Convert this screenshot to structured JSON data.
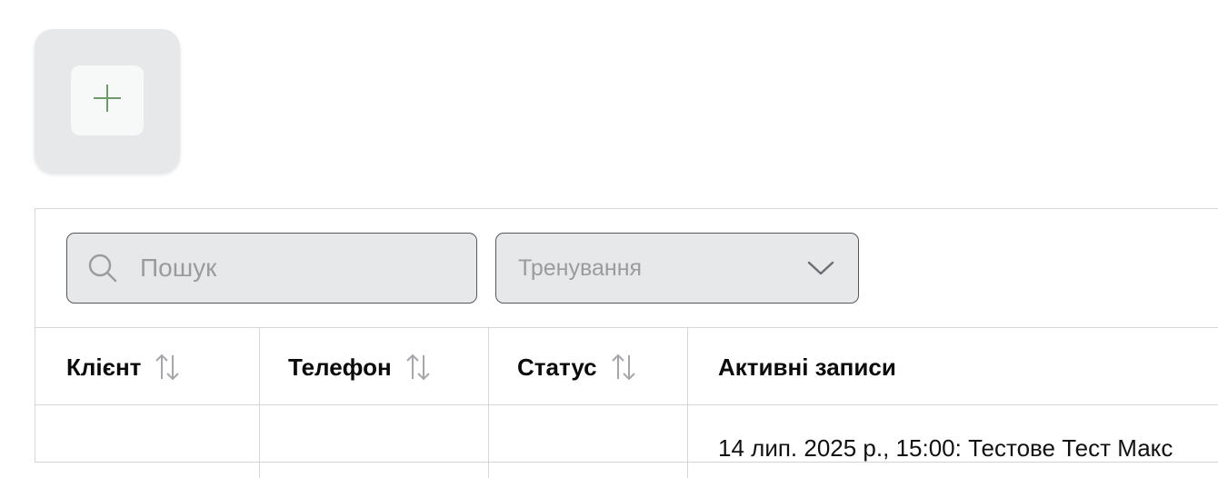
{
  "add_card": {
    "icon": "plus-icon",
    "accent_color": "#6f9a6a"
  },
  "filters": {
    "search": {
      "placeholder": "Пошук",
      "value": "",
      "icon": "search-icon"
    },
    "training_select": {
      "selected_label": "Тренування",
      "icon": "chevron-down-icon"
    }
  },
  "table": {
    "columns": [
      {
        "label": "Клієнт",
        "sortable": true
      },
      {
        "label": "Телефон",
        "sortable": true
      },
      {
        "label": "Статус",
        "sortable": true
      },
      {
        "label": "Активні записи",
        "sortable": false
      }
    ],
    "rows": [
      {
        "client": "",
        "phone": "",
        "status": "",
        "active_records": "14 лип. 2025 р., 15:00: Тестове Тест Макс"
      }
    ]
  },
  "colors": {
    "field_background": "#e7e8ea",
    "field_border": "#55575c",
    "placeholder_text": "#9a9b9e",
    "divider": "#d6d6d8"
  }
}
